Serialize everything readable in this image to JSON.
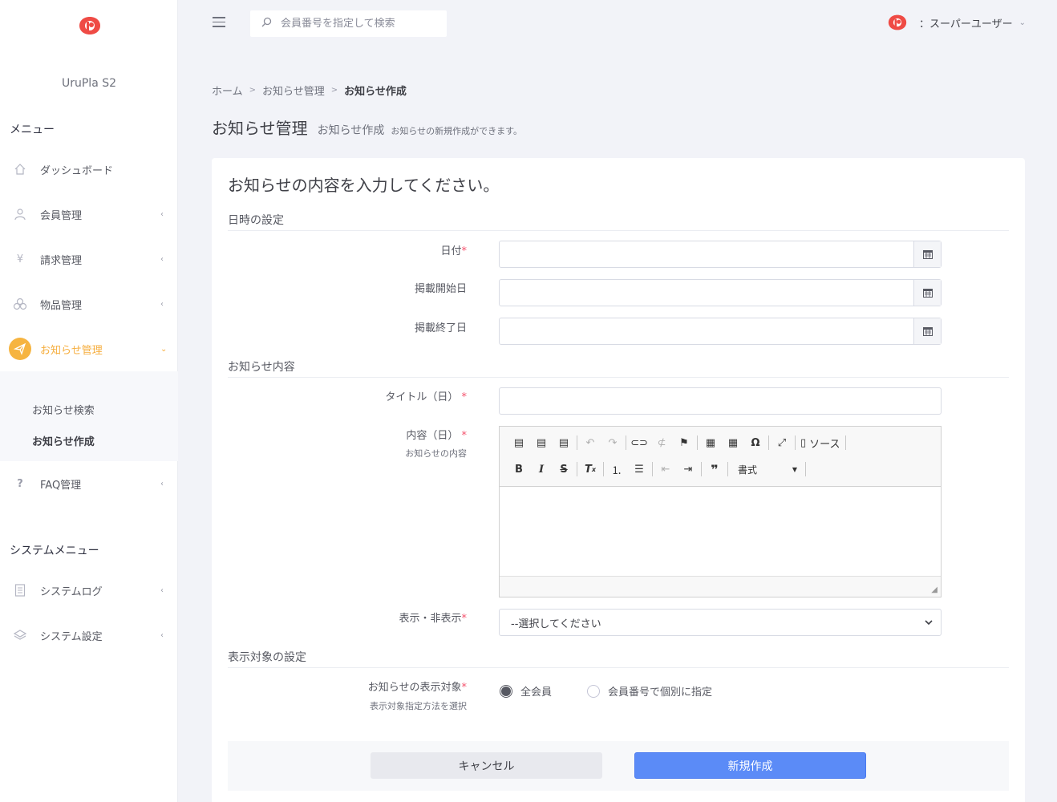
{
  "app": {
    "name": "UruPla S2"
  },
  "sidebar": {
    "menu_header": "メニュー",
    "system_header": "システムメニュー",
    "items": [
      {
        "label": "ダッシュボード",
        "icon": "home-icon"
      },
      {
        "label": "会員管理",
        "icon": "user-icon"
      },
      {
        "label": "請求管理",
        "icon": "yen-icon"
      },
      {
        "label": "物品管理",
        "icon": "boxes-icon"
      },
      {
        "label": "お知らせ管理",
        "icon": "paper-plane-icon"
      },
      {
        "label": "FAQ管理",
        "icon": "question-icon"
      }
    ],
    "submenu": [
      "お知らせ検索",
      "お知らせ作成"
    ],
    "system_items": [
      {
        "label": "システムログ",
        "icon": "document-icon"
      },
      {
        "label": "システム設定",
        "icon": "layers-icon"
      }
    ],
    "active_color": "#f6ad3c"
  },
  "topbar": {
    "search_placeholder": "会員番号を指定して検索",
    "user_label": "：スーパーユーザー"
  },
  "breadcrumb": [
    "ホーム",
    "お知らせ管理",
    "お知らせ作成"
  ],
  "page": {
    "title": "お知らせ管理",
    "subtitle": "お知らせ作成",
    "description": "お知らせの新規作成ができます。"
  },
  "form": {
    "heading": "お知らせの内容を入力してください。",
    "section_datetime": "日時の設定",
    "label_date": "日付",
    "label_start": "掲載開始日",
    "label_end": "掲載終了日",
    "section_content": "お知らせ内容",
    "label_title": "タイトル（日）",
    "label_body": "内容（日）",
    "hint_body": "お知らせの内容",
    "editor_source": "ソース",
    "editor_format": "書式",
    "label_visibility": "表示・非表示",
    "visibility_value": "--選択してください",
    "section_target": "表示対象の設定",
    "label_target": "お知らせの表示対象",
    "hint_target": "表示対象指定方法を選択",
    "radio_all": "全会員",
    "radio_individual": "会員番号で個別に指定",
    "required_mark": "*",
    "cancel": "キャンセル",
    "create": "新規作成"
  },
  "colors": {
    "primary": "#5b8bf7",
    "required": "#f4516c",
    "accent": "#f6ad3c"
  }
}
